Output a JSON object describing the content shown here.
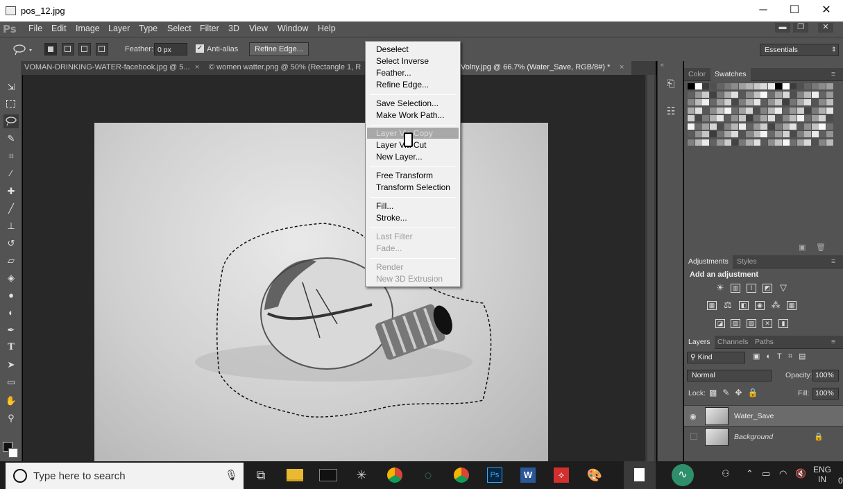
{
  "window": {
    "title": "pos_12.jpg",
    "min": "─",
    "max": "☐",
    "close": "✕"
  },
  "menubar": {
    "logo": "Ps",
    "items": [
      "File",
      "Edit",
      "Image",
      "Layer",
      "Type",
      "Select",
      "Filter",
      "3D",
      "View",
      "Window",
      "Help"
    ],
    "ctl_min": "▬",
    "ctl_restore": "❐",
    "ctl_close": "✕"
  },
  "options": {
    "feather_label": "Feather:",
    "feather_value": "0 px",
    "antialias_label": "Anti-alias",
    "antialias_checked": true,
    "refine_label": "Refine Edge...",
    "workspace": "Essentials"
  },
  "doc_tabs": [
    "VOMAN-DRINKING-WATER-facebook.jpg @ 5...",
    "© women watter.png @ 50% (Rectangle 1, R",
    "Volny.jpg @ 66.7% (Water_Save, RGB/8#) *"
  ],
  "context_menu": {
    "items": [
      {
        "label": "Deselect",
        "enabled": true
      },
      {
        "label": "Select Inverse",
        "enabled": true
      },
      {
        "label": "Feather...",
        "enabled": true
      },
      {
        "label": "Refine Edge...",
        "enabled": true
      },
      {
        "label": "Save Selection...",
        "enabled": true
      },
      {
        "label": "Make Work Path...",
        "enabled": true
      },
      {
        "label": "Layer Via Copy",
        "enabled": true,
        "highlighted": true
      },
      {
        "label": "Layer Via Cut",
        "enabled": true
      },
      {
        "label": "New Layer...",
        "enabled": true
      },
      {
        "label": "Free Transform",
        "enabled": true
      },
      {
        "label": "Transform Selection",
        "enabled": true
      },
      {
        "label": "Fill...",
        "enabled": true
      },
      {
        "label": "Stroke...",
        "enabled": true
      },
      {
        "label": "Last Filter",
        "enabled": false
      },
      {
        "label": "Fade...",
        "enabled": false
      },
      {
        "label": "Render",
        "enabled": false
      },
      {
        "label": "New 3D Extrusion",
        "enabled": false
      }
    ]
  },
  "swatches_panel": {
    "tabs": [
      "Color",
      "Swatches"
    ],
    "active": "Swatches"
  },
  "adjustments_panel": {
    "tabs": [
      "Adjustments",
      "Styles"
    ],
    "heading": "Add an adjustment"
  },
  "layers_panel": {
    "tabs": [
      "Layers",
      "Channels",
      "Paths"
    ],
    "filter_kind": "Kind",
    "blend_mode": "Normal",
    "opacity_label": "Opacity:",
    "opacity_value": "100%",
    "lock_label": "Lock:",
    "fill_label": "Fill:",
    "fill_value": "100%",
    "layers": [
      {
        "name": "Water_Save",
        "visible": true,
        "selected": true,
        "locked": false
      },
      {
        "name": "Background",
        "visible": false,
        "selected": false,
        "locked": true
      }
    ]
  },
  "taskbar": {
    "search_placeholder": "Type here to search",
    "lang": "ENG",
    "region": "IN",
    "time_fragment": "0"
  },
  "colors": {
    "ps_panel": "#535353",
    "ps_dark": "#282828",
    "menu_bg": "#f0f0f0",
    "highlight": "#a8a8a8"
  }
}
